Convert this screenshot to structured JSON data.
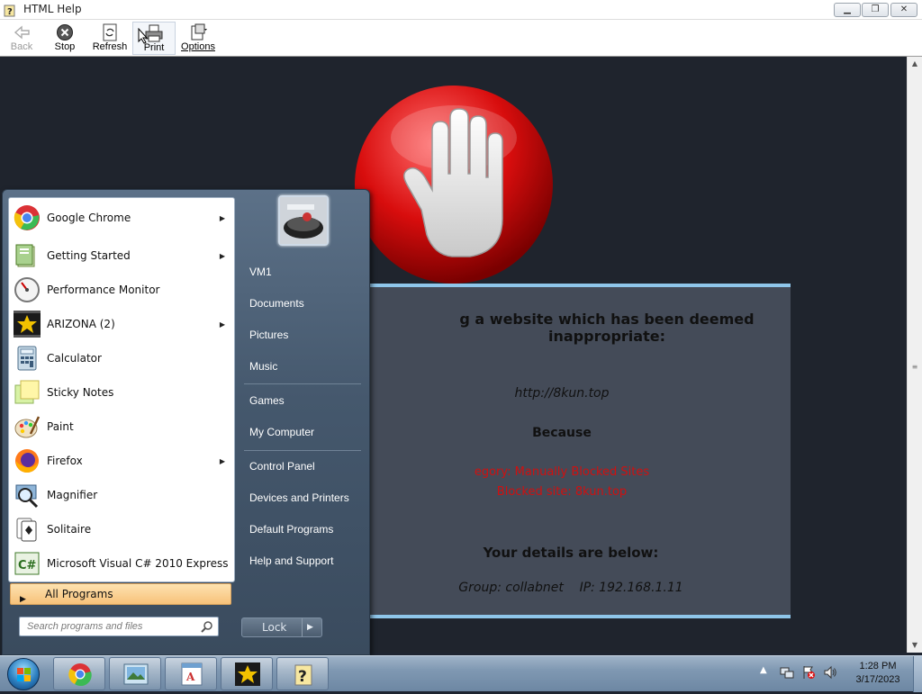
{
  "window": {
    "title": "HTML Help",
    "controls": {
      "minimize": "minimize-icon",
      "maximize": "restore-icon",
      "close": "close-icon"
    }
  },
  "toolbar": {
    "back": "Back",
    "stop": "Stop",
    "refresh": "Refresh",
    "print": "Print",
    "options": "Options"
  },
  "blockpage": {
    "heading": "g a website which has been deemed inappropriate:",
    "url": "http://8kun.top",
    "because": "Because",
    "category": "egory: Manually Blocked Sites",
    "blocked_site": "Blocked site: 8kun.top",
    "details_heading": "Your details are below:",
    "group_ip": "Group: collabnet    IP: 192.168.1.11",
    "accent_color": "#d01010",
    "border_color": "#8fc6ea"
  },
  "start_menu": {
    "programs": [
      {
        "label": "Google Chrome",
        "icon": "chrome-icon",
        "submenu": true
      },
      {
        "label": "Getting Started",
        "icon": "getting-started-icon",
        "submenu": true
      },
      {
        "label": "Performance Monitor",
        "icon": "performance-monitor-icon",
        "submenu": false
      },
      {
        "label": "ARIZONA (2)",
        "icon": "arizona-star-icon",
        "submenu": true
      },
      {
        "label": "Calculator",
        "icon": "calculator-icon",
        "submenu": false
      },
      {
        "label": "Sticky Notes",
        "icon": "sticky-notes-icon",
        "submenu": false
      },
      {
        "label": "Paint",
        "icon": "paint-icon",
        "submenu": false
      },
      {
        "label": "Firefox",
        "icon": "firefox-icon",
        "submenu": true
      },
      {
        "label": "Magnifier",
        "icon": "magnifier-icon",
        "submenu": false
      },
      {
        "label": "Solitaire",
        "icon": "solitaire-icon",
        "submenu": false
      },
      {
        "label": "Microsoft Visual C# 2010 Express",
        "icon": "visual-csharp-icon",
        "submenu": false
      }
    ],
    "all_programs": "All Programs",
    "search_placeholder": "Search programs and files",
    "right_items": [
      "VM1",
      "Documents",
      "Pictures",
      "Music",
      "Games",
      "My Computer",
      "Control Panel",
      "Devices and Printers",
      "Default Programs",
      "Help and Support"
    ],
    "lock_label": "Lock"
  },
  "taskbar": {
    "apps": [
      "chrome-icon",
      "picture-viewer-icon",
      "wordpad-icon",
      "arizona-star-icon",
      "html-help-icon"
    ],
    "clock_time": "1:28 PM",
    "clock_date": "3/17/2023"
  }
}
